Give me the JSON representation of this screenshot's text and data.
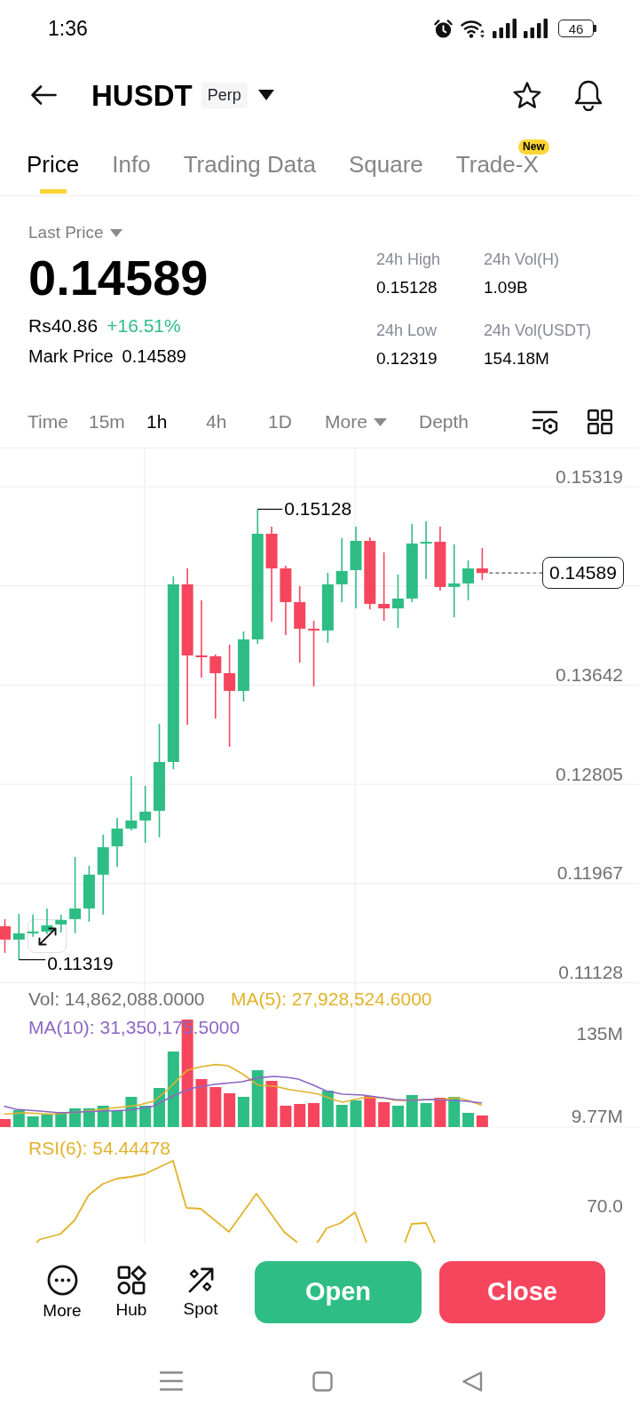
{
  "status_bar": {
    "time": "1:36",
    "battery": "46"
  },
  "header": {
    "symbol": "HUSDT",
    "badge": "Perp"
  },
  "tabs": [
    {
      "label": "Price",
      "selected": true
    },
    {
      "label": "Info",
      "selected": false
    },
    {
      "label": "Trading Data",
      "selected": false
    },
    {
      "label": "Square",
      "selected": false
    },
    {
      "label": "Trade-X",
      "selected": false,
      "badge": "New"
    }
  ],
  "price": {
    "label": "Last Price",
    "value": "0.14589",
    "fiat": "Rs40.86",
    "change": "+16.51%",
    "mark_label": "Mark Price",
    "mark_value": "0.14589"
  },
  "stats": [
    {
      "label": "24h High",
      "value": "0.15128"
    },
    {
      "label": "24h Vol(H)",
      "value": "1.09B"
    },
    {
      "label": "24h Low",
      "value": "0.12319"
    },
    {
      "label": "24h Vol(USDT)",
      "value": "154.18M"
    }
  ],
  "intervals": [
    {
      "label": "Time",
      "kind": "option",
      "selected": false
    },
    {
      "label": "15m",
      "kind": "option",
      "selected": false
    },
    {
      "label": "1h",
      "kind": "option",
      "selected": true
    },
    {
      "label": "4h",
      "kind": "option",
      "selected": false
    },
    {
      "label": "1D",
      "kind": "option",
      "selected": false
    },
    {
      "label": "More",
      "kind": "dropdown",
      "selected": false
    },
    {
      "label": "Depth",
      "kind": "option",
      "selected": false
    }
  ],
  "chart": {
    "chart_data": {
      "type": "candlestick",
      "ohlc": [
        [
          0.11602,
          0.11662,
          0.11377,
          0.11489
        ],
        [
          0.11489,
          0.11707,
          0.11319,
          0.11542
        ],
        [
          0.11542,
          0.117,
          0.11512,
          0.11557
        ],
        [
          0.11557,
          0.11752,
          0.11535,
          0.1161
        ],
        [
          0.11617,
          0.117,
          0.1155,
          0.11655
        ],
        [
          0.11662,
          0.12188,
          0.11542,
          0.11752
        ],
        [
          0.11752,
          0.12113,
          0.1164,
          0.12038
        ],
        [
          0.12038,
          0.12376,
          0.117,
          0.1227
        ],
        [
          0.12278,
          0.12518,
          0.12105,
          0.12428
        ],
        [
          0.12428,
          0.12871,
          0.12413,
          0.12496
        ],
        [
          0.12496,
          0.12789,
          0.12308,
          0.12571
        ],
        [
          0.12578,
          0.13314,
          0.12353,
          0.12991
        ],
        [
          0.12991,
          0.14561,
          0.12931,
          0.14493
        ],
        [
          0.14493,
          0.14628,
          0.13307,
          0.13892
        ],
        [
          0.13892,
          0.14358,
          0.13705,
          0.13877
        ],
        [
          0.13885,
          0.139,
          0.13359,
          0.13742
        ],
        [
          0.13742,
          0.13982,
          0.13119,
          0.13592
        ],
        [
          0.13592,
          0.14095,
          0.13502,
          0.14028
        ],
        [
          0.14028,
          0.15128,
          0.1399,
          0.14921
        ],
        [
          0.14921,
          0.14981,
          0.14178,
          0.14628
        ],
        [
          0.14628,
          0.14651,
          0.14065,
          0.14343
        ],
        [
          0.14343,
          0.14478,
          0.13832,
          0.14118
        ],
        [
          0.14118,
          0.14185,
          0.1363,
          0.14103
        ],
        [
          0.14103,
          0.14591,
          0.13997,
          0.14493
        ],
        [
          0.14493,
          0.14883,
          0.14343,
          0.14606
        ],
        [
          0.14613,
          0.14981,
          0.1429,
          0.14861
        ],
        [
          0.14861,
          0.14891,
          0.14283,
          0.14328
        ],
        [
          0.14328,
          0.14763,
          0.14185,
          0.1429
        ],
        [
          0.1429,
          0.14576,
          0.14125,
          0.14373
        ],
        [
          0.14373,
          0.15004,
          0.14343,
          0.14838
        ],
        [
          0.14838,
          0.15026,
          0.14538,
          0.14853
        ],
        [
          0.14853,
          0.14981,
          0.1444,
          0.14471
        ],
        [
          0.14471,
          0.14831,
          0.14215,
          0.14501
        ],
        [
          0.14501,
          0.14696,
          0.14358,
          0.14628
        ],
        [
          0.14628,
          0.14801,
          0.14531,
          0.14589
        ]
      ],
      "ylim": [
        0.11128,
        0.15642
      ],
      "yticks": [
        0.15319,
        0.13642,
        0.12805,
        0.11967,
        0.11128
      ],
      "grid": true
    },
    "high_label": "0.15128",
    "low_label": "0.11319",
    "last_price_tag": "0.14589"
  },
  "volume": {
    "vol": "Vol: 14,862,088.0000",
    "ma5": "MA(5): 27,928,524.6000",
    "ma10": "MA(10): 31,350,175.5000",
    "axis": [
      "135M",
      "9.77M"
    ]
  },
  "rsi": {
    "label": "RSI(6): 54.44478",
    "axis": [
      "70.0"
    ]
  },
  "bottom_bar": {
    "tools": [
      {
        "label": "More"
      },
      {
        "label": "Hub"
      },
      {
        "label": "Spot"
      }
    ],
    "buttons": [
      {
        "label": "Open",
        "kind": "buy"
      },
      {
        "label": "Close",
        "kind": "sell"
      }
    ]
  }
}
